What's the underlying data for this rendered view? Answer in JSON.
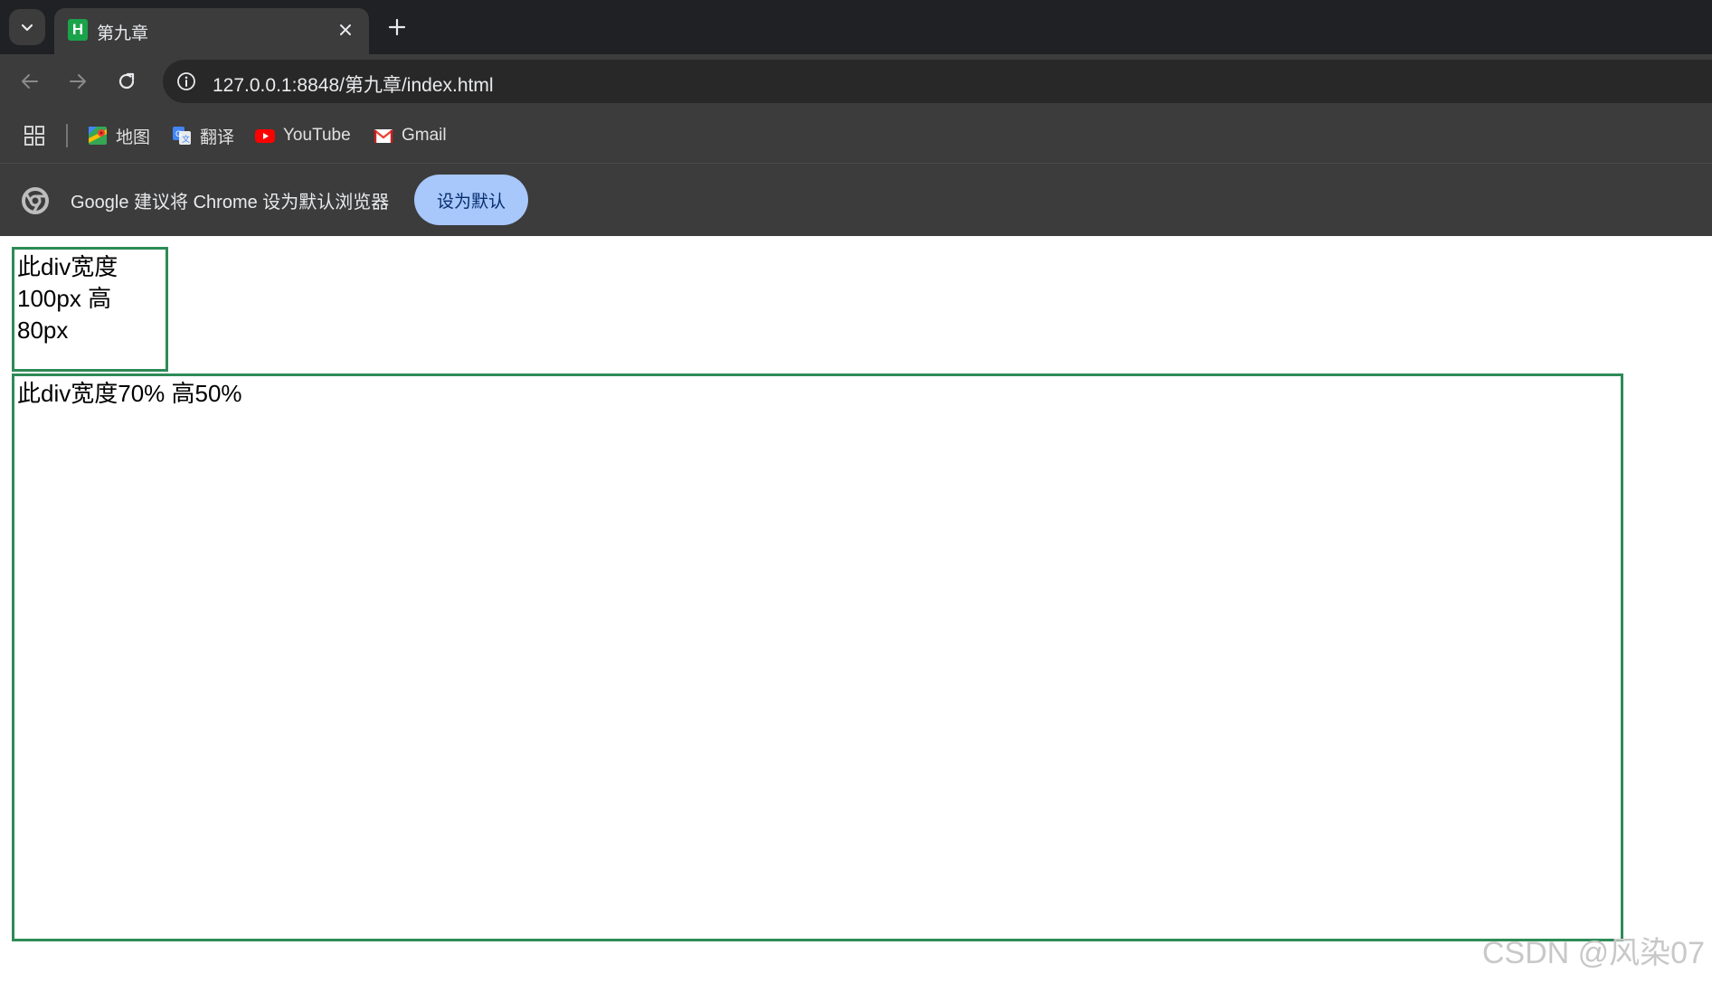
{
  "browser": {
    "tab": {
      "favicon_letter": "H",
      "title": "第九章"
    },
    "address_bar": {
      "url": "127.0.0.1:8848/第九章/index.html"
    },
    "bookmarks": [
      {
        "label": "地图",
        "icon": "maps-icon"
      },
      {
        "label": "翻译",
        "icon": "translate-icon"
      },
      {
        "label": "YouTube",
        "icon": "youtube-icon"
      },
      {
        "label": "Gmail",
        "icon": "gmail-icon"
      }
    ],
    "infobar": {
      "message": "Google 建议将 Chrome 设为默认浏览器",
      "button_label": "设为默认"
    }
  },
  "page": {
    "fixed_box": {
      "line1": "此div宽度",
      "line2": "100px 高",
      "line3": "80px"
    },
    "percent_box": {
      "text": "此div宽度70% 高50%"
    },
    "border_color": "#2e8b57"
  },
  "watermark": "CSDN @风染07"
}
